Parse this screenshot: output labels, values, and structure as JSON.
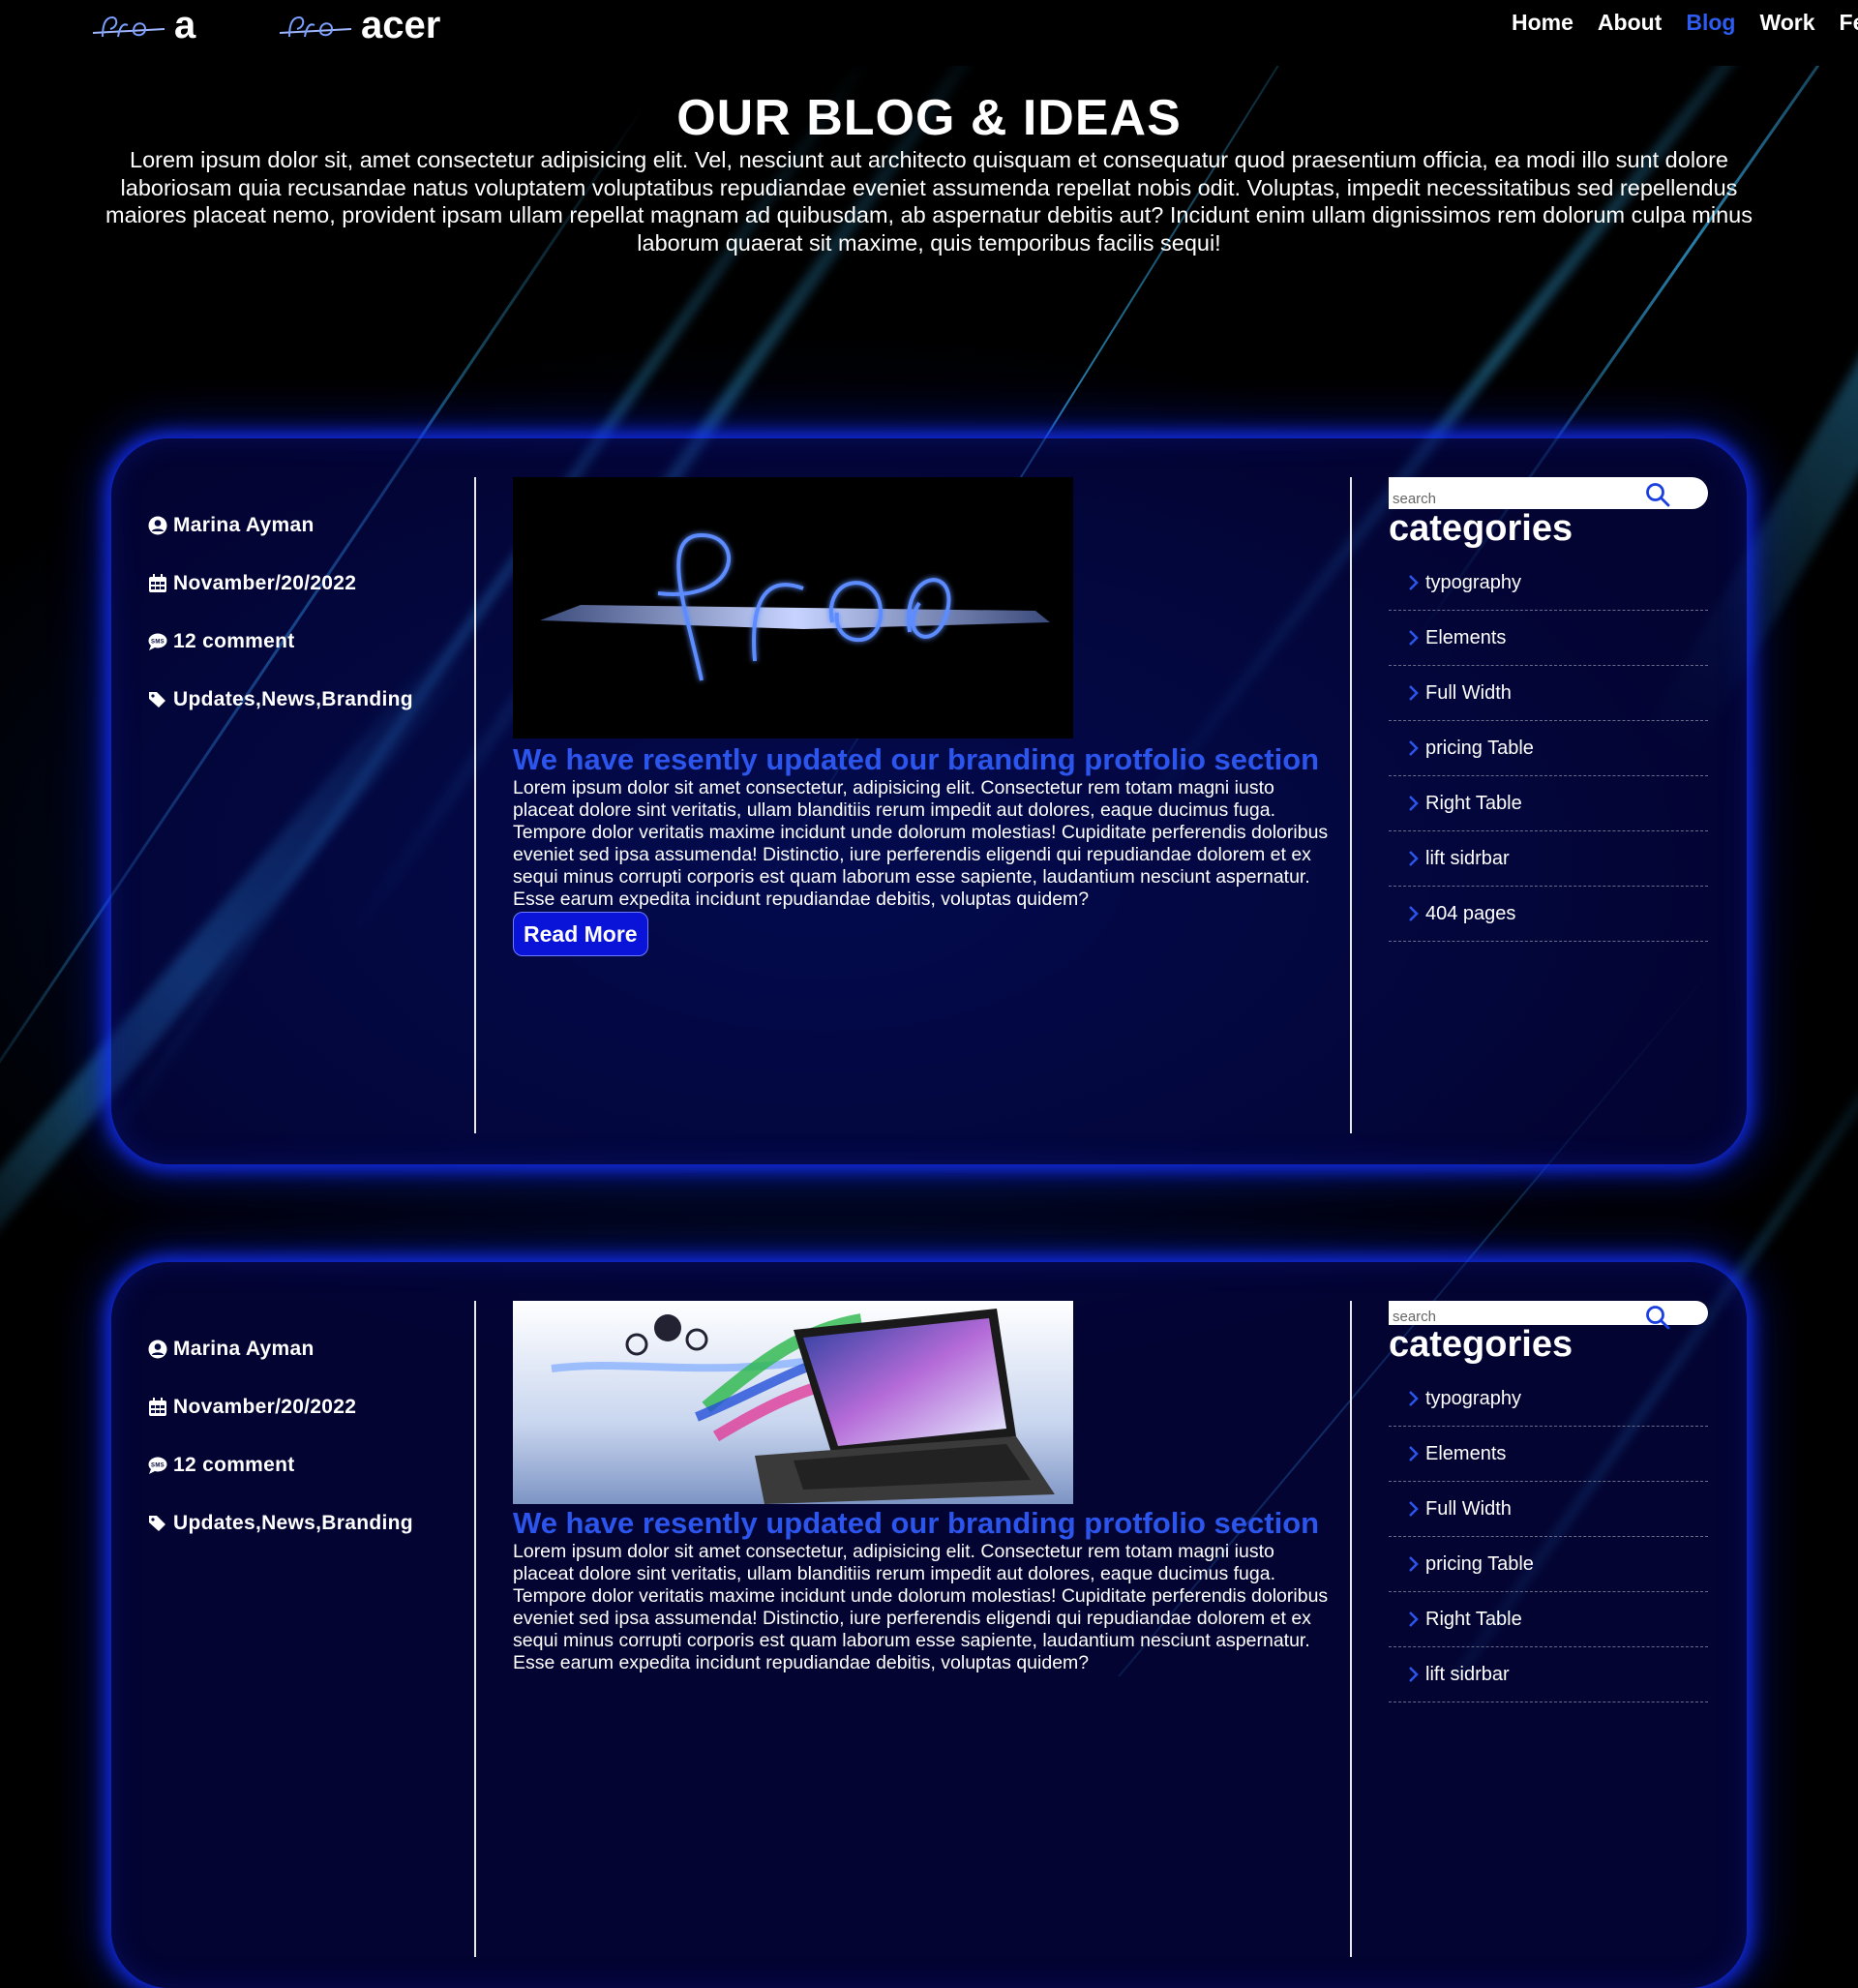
{
  "brand": {
    "text_1": "a",
    "text_2": "acer"
  },
  "nav": {
    "items": [
      {
        "label": "Home"
      },
      {
        "label": "About"
      },
      {
        "label": "Blog"
      },
      {
        "label": "Work"
      },
      {
        "label": "Fea"
      }
    ],
    "active_color": "#2e5cf0"
  },
  "hero": {
    "title": "OUR BLOG & IDEAS",
    "text": "Lorem ipsum dolor sit, amet consectetur adipisicing elit. Vel, nesciunt aut architecto quisquam et consequatur quod praesentium officia, ea modi illo sunt dolore laboriosam quia recusandae natus voluptatem voluptatibus repudiandae eveniet assumenda repellat nobis odit. Voluptas, impedit necessitatibus sed repellendus maiores placeat nemo, provident ipsam ullam repellat magnam ad quibusdam, ab aspernatur debitis aut? Incidunt enim ullam dignissimos rem dolorum culpa minus laborum quaerat sit maxime, quis temporibus facilis sequi!"
  },
  "posts": [
    {
      "author": "Marina Ayman",
      "date": "Novamber/20/2022",
      "comments": "12 comment",
      "tags": "Updates,News,Branding",
      "title": "We have resently updated our branding protfolio section",
      "body": "Lorem ipsum dolor sit amet consectetur, adipisicing elit. Consectetur rem totam magni iusto placeat dolore sint veritatis, ullam blanditiis rerum impedit aut dolores, eaque ducimus fuga. Tempore dolor veritatis maxime incidunt unde dolorum molestias! Cupiditate perferendis doloribus eveniet sed ipsa assumenda! Distinctio, iure perferendis eligendi qui repudiandae dolorem et ex sequi minus corrupti corporis est quam laborum esse sapiente, laudantium nesciunt aspernatur. Esse earum expedita incidunt repudiandae debitis, voluptas quidem?",
      "read_more": "Read More"
    },
    {
      "author": "Marina Ayman",
      "date": "Novamber/20/2022",
      "comments": "12 comment",
      "tags": "Updates,News,Branding",
      "title": "We have resently updated our branding protfolio section",
      "body": "Lorem ipsum dolor sit amet consectetur, adipisicing elit. Consectetur rem totam magni iusto placeat dolore sint veritatis, ullam blanditiis rerum impedit aut dolores, eaque ducimus fuga. Tempore dolor veritatis maxime incidunt unde dolorum molestias! Cupiditate perferendis doloribus eveniet sed ipsa assumenda! Distinctio, iure perferendis eligendi qui repudiandae dolorem et ex sequi minus corrupti corporis est quam laborum esse sapiente, laudantium nesciunt aspernatur. Esse earum expedita incidunt repudiandae debitis, voluptas quidem?"
    }
  ],
  "sidebar": {
    "search_placeholder": "search",
    "categories_title": "categories",
    "categories": [
      {
        "label": "typography"
      },
      {
        "label": "Elements"
      },
      {
        "label": "Full Width"
      },
      {
        "label": "pricing Table"
      },
      {
        "label": "Right Table"
      },
      {
        "label": "lift sidrbar"
      },
      {
        "label": "404 pages"
      }
    ]
  },
  "icons": {
    "author": "user-circle-icon",
    "date": "calendar-icon",
    "comments": "sms-chat-icon",
    "tags": "tags-icon",
    "search": "search-icon",
    "category": "chevron-right-icon"
  },
  "colors": {
    "accent": "#2b55ec",
    "button": "#0a13d8",
    "glow": "#1432ff"
  }
}
